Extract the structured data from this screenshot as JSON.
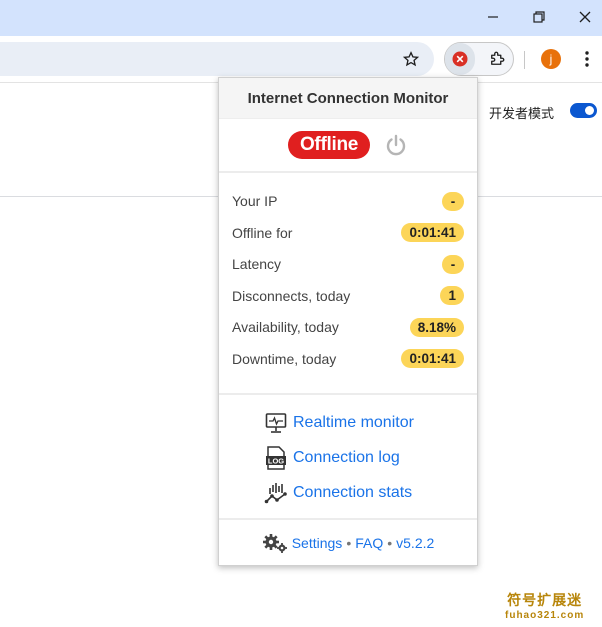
{
  "window": {
    "minimize_icon": "minimize-icon",
    "maximize_icon": "restore-icon",
    "close_icon": "close-icon"
  },
  "toolbar": {
    "profile_initial": "j",
    "colors": {
      "profile": "#e8710a",
      "ext_error": "#d93025"
    }
  },
  "page": {
    "dev_mode_label": "开发者模式",
    "dev_mode_on": true
  },
  "popup": {
    "title": "Internet Connection Monitor",
    "status": "Offline",
    "stats": [
      {
        "label": "Your IP",
        "value": "-"
      },
      {
        "label": "Offline for",
        "value": "0:01:41"
      },
      {
        "label": "Latency",
        "value": "-"
      },
      {
        "label": "Disconnects, today",
        "value": "1"
      },
      {
        "label": "Availability, today",
        "value": "8.18%"
      },
      {
        "label": "Downtime, today",
        "value": "0:01:41"
      }
    ],
    "links": [
      {
        "label": "Realtime monitor",
        "icon": "monitor-icon"
      },
      {
        "label": "Connection log",
        "icon": "log-icon"
      },
      {
        "label": "Connection stats",
        "icon": "stats-icon"
      }
    ],
    "footer": {
      "settings": "Settings",
      "sep1": "•",
      "faq": "FAQ",
      "sep2": "•",
      "version": "v5.2.2"
    },
    "colors": {
      "offline": "#e01f1f",
      "pill": "#fcd558",
      "link": "#1a73e8"
    }
  },
  "watermark": {
    "line1": "符号扩展迷",
    "line2": "fuhao321.com"
  }
}
